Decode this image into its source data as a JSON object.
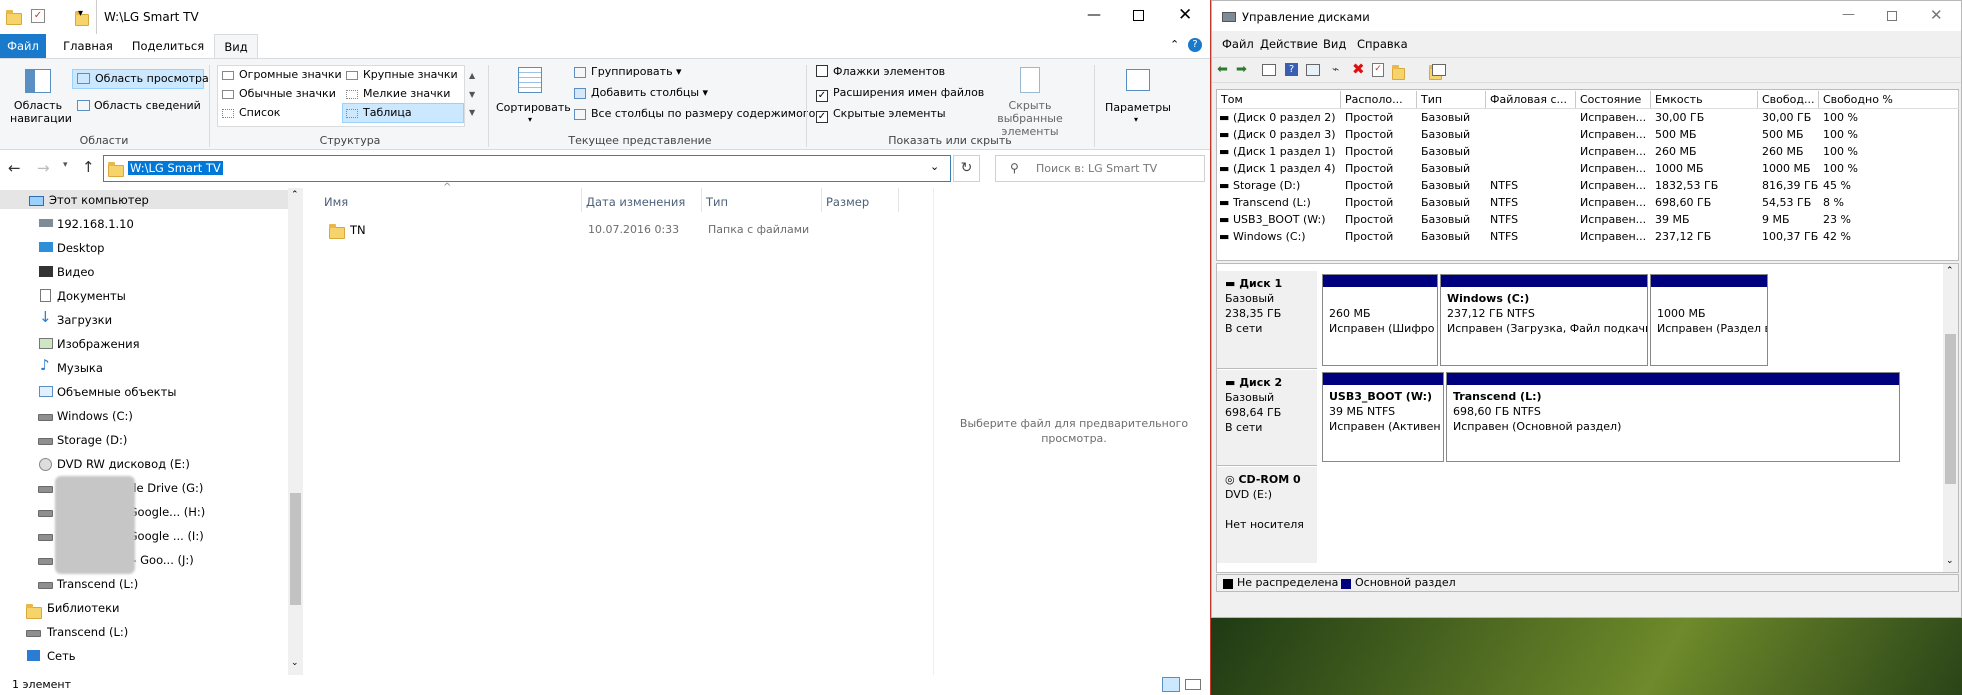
{
  "explorer": {
    "title": "W:\\LG Smart TV",
    "tabs": [
      "Файл",
      "Главная",
      "Поделиться",
      "Вид"
    ],
    "ribbon": {
      "nav_pane": "Область навигации",
      "preview_pane": "Область просмотра",
      "details_pane": "Область сведений",
      "group_panes": "Области",
      "layouts": [
        "Огромные значки",
        "Крупные значки",
        "Обычные значки",
        "Мелкие значки",
        "Список",
        "Таблица"
      ],
      "group_layout": "Структура",
      "sort": "Сортировать",
      "group_by": "Группировать",
      "add_columns": "Добавить столбцы",
      "fit_columns": "Все столбцы по размеру содержимого",
      "group_view": "Текущее представление",
      "cb_flags": "Флажки элементов",
      "cb_ext": "Расширения имен файлов",
      "cb_hidden": "Скрытые элементы",
      "hide_selected": "Скрыть выбранные элементы",
      "group_show": "Показать или скрыть",
      "options": "Параметры"
    },
    "address": "W:\\LG Smart TV",
    "search_placeholder": "Поиск в: LG Smart TV",
    "nav": [
      "Этот компьютер",
      "192.168.1.10",
      "Desktop",
      "Видео",
      "Документы",
      "Загрузки",
      "Изображения",
      "Музыка",
      "Объемные объекты",
      "Windows (C:)",
      "Storage (D:)",
      "DVD RW дисковод (E:)",
      "il.com - Google Drive (G:)",
      "gmail.com - Google... (H:)",
      "gmail.com - Google ... (I:)",
      "@gmail.com - Goo... (J:)",
      "Transcend (L:)",
      "Библиотеки",
      "Transcend (L:)",
      "Сеть"
    ],
    "columns": [
      "Имя",
      "Дата изменения",
      "Тип",
      "Размер"
    ],
    "files": [
      {
        "name": "TN",
        "date": "10.07.2016 0:33",
        "type": "Папка с файлами"
      }
    ],
    "preview_text": "Выберите файл для предварительного просмотра.",
    "status": "1 элемент"
  },
  "dm": {
    "title": "Управление дисками",
    "menu": [
      "Файл",
      "Действие",
      "Вид",
      "Справка"
    ],
    "columns": [
      "Том",
      "Располо...",
      "Тип",
      "Файловая с...",
      "Состояние",
      "Емкость",
      "Свобод...",
      "Свободно %"
    ],
    "rows": [
      [
        "(Диск 0 раздел 2)",
        "Простой",
        "Базовый",
        "",
        "Исправен...",
        "30,00 ГБ",
        "30,00 ГБ",
        "100 %"
      ],
      [
        "(Диск 0 раздел 3)",
        "Простой",
        "Базовый",
        "",
        "Исправен...",
        "500 МБ",
        "500 МБ",
        "100 %"
      ],
      [
        "(Диск 1 раздел 1)",
        "Простой",
        "Базовый",
        "",
        "Исправен...",
        "260 МБ",
        "260 МБ",
        "100 %"
      ],
      [
        "(Диск 1 раздел 4)",
        "Простой",
        "Базовый",
        "",
        "Исправен...",
        "1000 МБ",
        "1000 МБ",
        "100 %"
      ],
      [
        "Storage (D:)",
        "Простой",
        "Базовый",
        "NTFS",
        "Исправен...",
        "1832,53 ГБ",
        "816,39 ГБ",
        "45 %"
      ],
      [
        "Transcend (L:)",
        "Простой",
        "Базовый",
        "NTFS",
        "Исправен...",
        "698,60 ГБ",
        "54,53 ГБ",
        "8 %"
      ],
      [
        "USB3_BOOT (W:)",
        "Простой",
        "Базовый",
        "NTFS",
        "Исправен...",
        "39 МБ",
        "9 МБ",
        "23 %"
      ],
      [
        "Windows (C:)",
        "Простой",
        "Базовый",
        "NTFS",
        "Исправен...",
        "237,12 ГБ",
        "100,37 ГБ",
        "42 %"
      ]
    ],
    "disk1": {
      "name": "Диск 1",
      "type": "Базовый",
      "size": "238,35 ГБ",
      "state": "В сети",
      "parts": [
        {
          "l1": "",
          "l2": "260 МБ",
          "l3": "Исправен (Шифро"
        },
        {
          "l1": "Windows  (C:)",
          "l2": "237,12 ГБ NTFS",
          "l3": "Исправен (Загрузка, Файл подкачки, Аварий"
        },
        {
          "l1": "",
          "l2": "1000 МБ",
          "l3": "Исправен (Раздел восст"
        }
      ]
    },
    "disk2": {
      "name": "Диск 2",
      "type": "Базовый",
      "size": "698,64 ГБ",
      "state": "В сети",
      "parts": [
        {
          "l1": "USB3_BOOT  (W:)",
          "l2": "39 МБ NTFS",
          "l3": "Исправен (Активен"
        },
        {
          "l1": "Transcend  (L:)",
          "l2": "698,60 ГБ NTFS",
          "l3": "Исправен (Основной раздел)"
        }
      ]
    },
    "cdrom": {
      "name": "CD-ROM 0",
      "type": "DVD (E:)",
      "state": "Нет носителя"
    },
    "legend": [
      "Не распределена",
      "Основной раздел"
    ]
  }
}
